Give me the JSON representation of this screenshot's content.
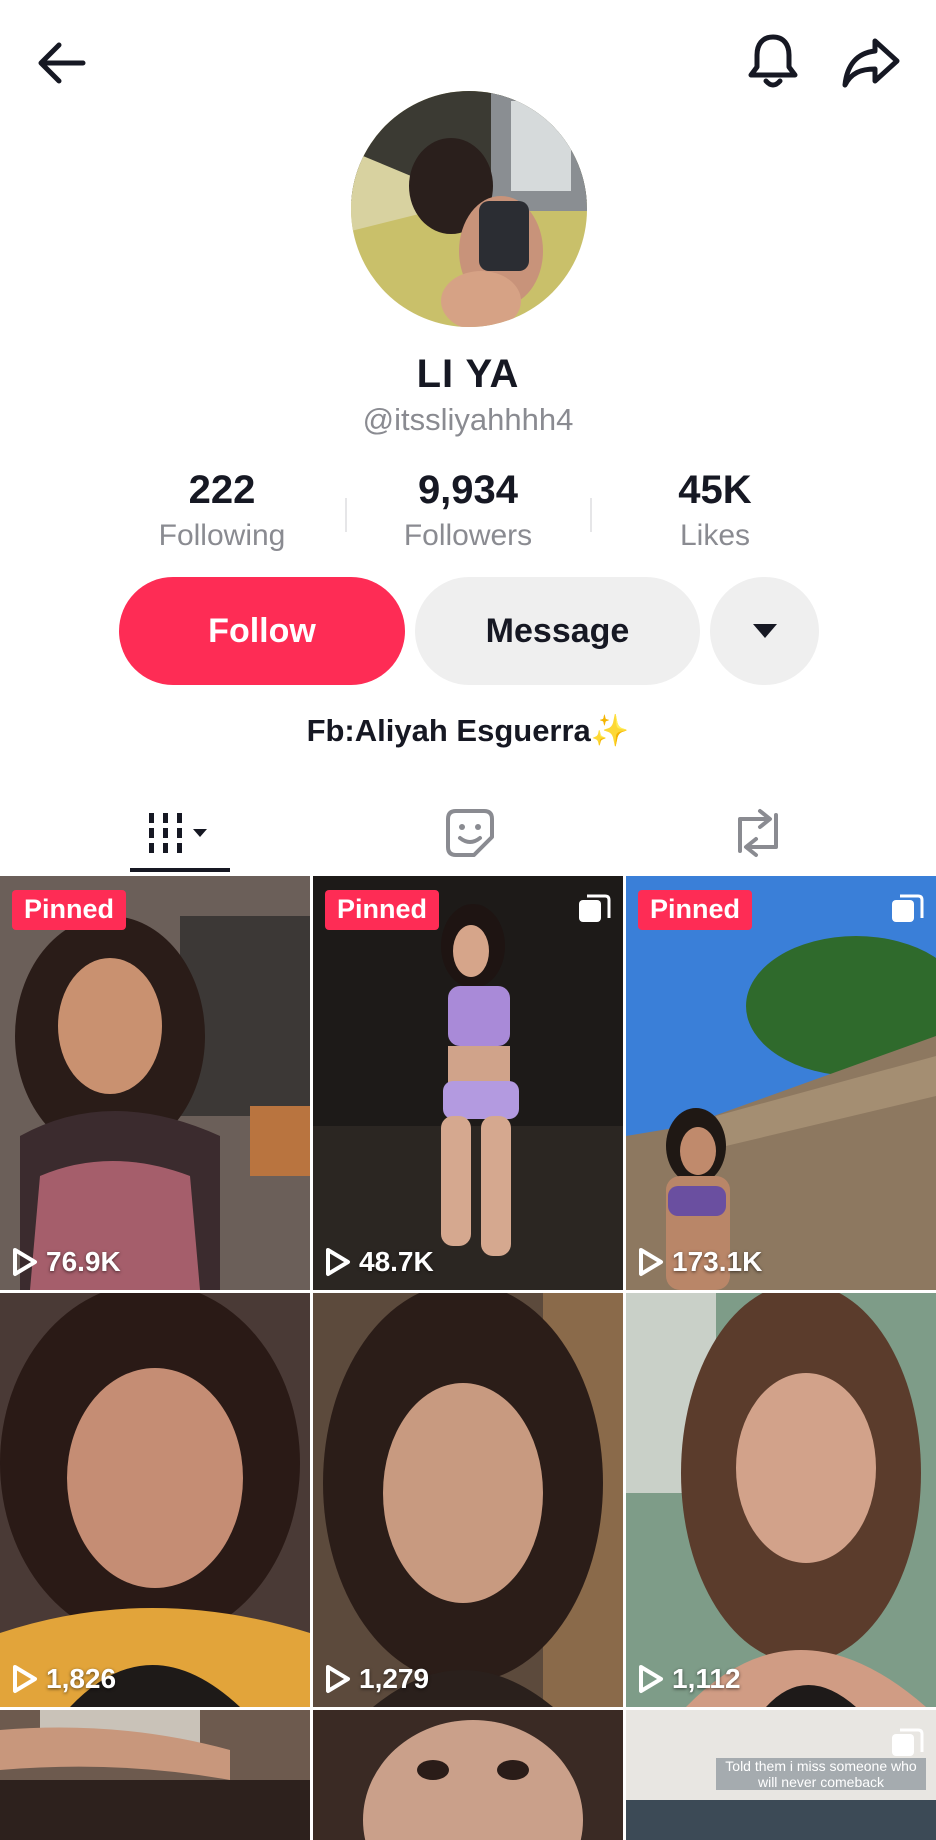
{
  "profile": {
    "display_name": "LI YA",
    "handle": "@itssliyahhhh4",
    "bio": "Fb:Aliyah Esguerra",
    "bio_emoji": "✨"
  },
  "stats": [
    {
      "value": "222",
      "label": "Following"
    },
    {
      "value": "9,934",
      "label": "Followers"
    },
    {
      "value": "45K",
      "label": "Likes"
    }
  ],
  "actions": {
    "follow_label": "Follow",
    "message_label": "Message"
  },
  "icons": {
    "back": "back-arrow-icon",
    "bell": "bell-icon",
    "share": "share-icon",
    "more": "caret-down-icon",
    "tab_videos": "grid-icon",
    "tab_favorites": "sticker-icon",
    "tab_reposts": "repost-icon"
  },
  "colors": {
    "accent": "#fe2c55",
    "secondary_button": "#efefef",
    "muted_text": "#8a8b91"
  },
  "videos": [
    {
      "views": "76.9K",
      "pinned": "Pinned",
      "multi": false
    },
    {
      "views": "48.7K",
      "pinned": "Pinned",
      "multi": true
    },
    {
      "views": "173.1K",
      "pinned": "Pinned",
      "multi": true
    },
    {
      "views": "1,826"
    },
    {
      "views": "1,279"
    },
    {
      "views": "1,112"
    },
    {
      "views": ""
    },
    {
      "views": ""
    },
    {
      "views": "",
      "caption": "Told them i miss someone who will never comeback",
      "multi": true
    }
  ]
}
